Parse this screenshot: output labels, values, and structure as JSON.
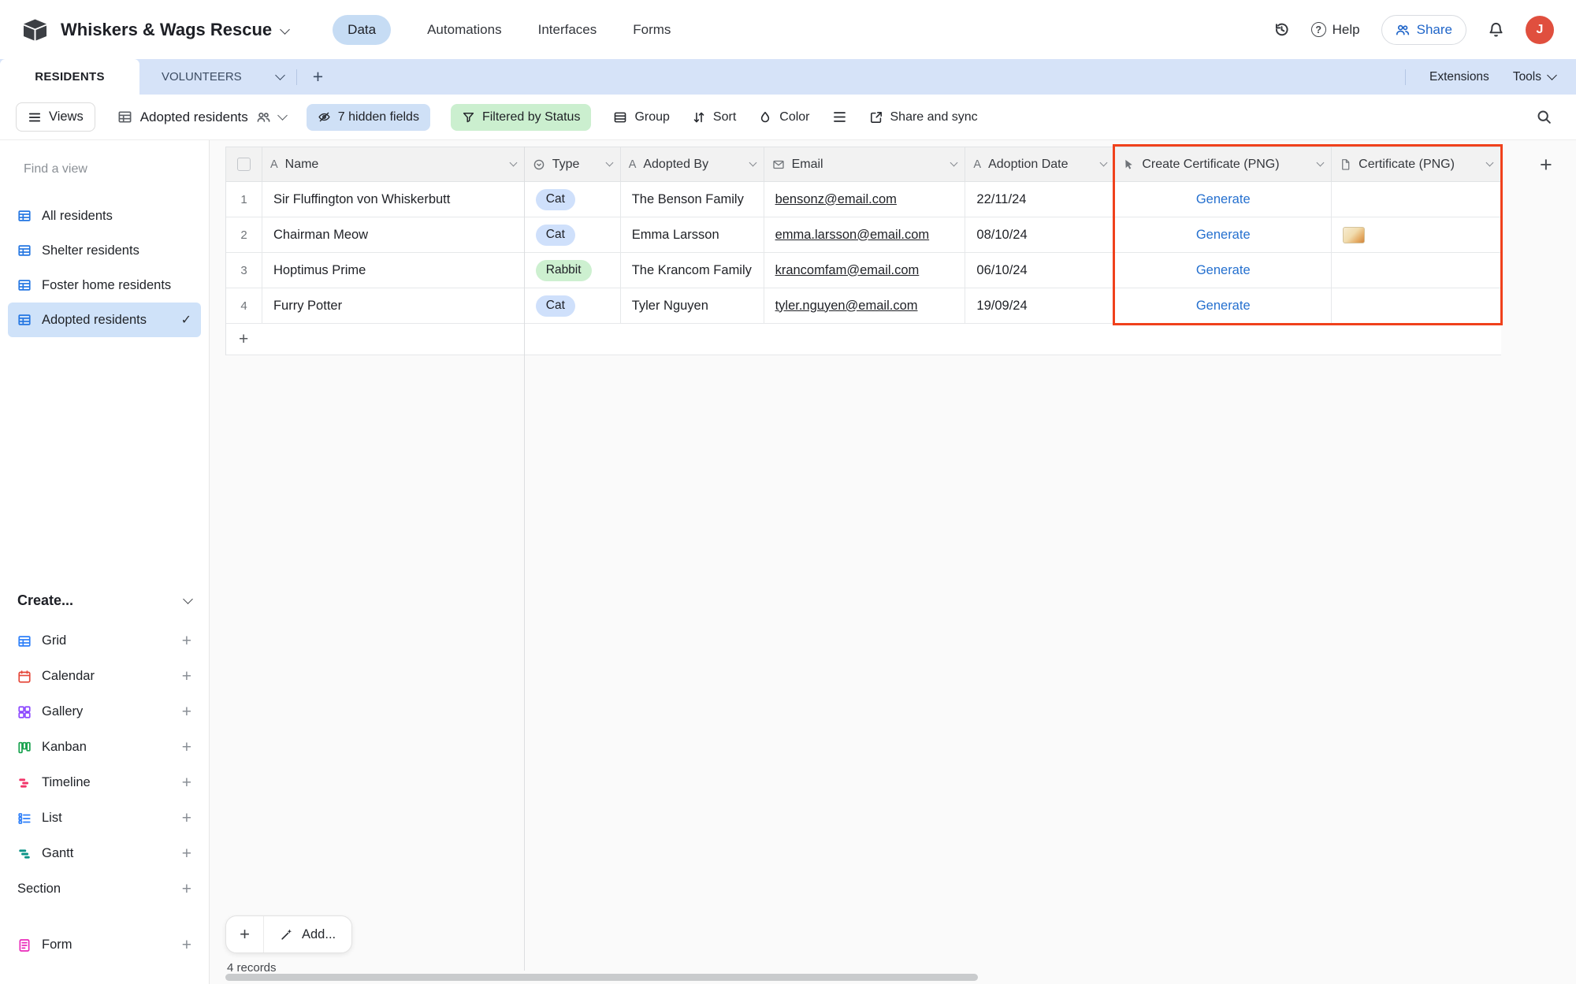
{
  "colors": {
    "accent_blue": "#2d7ff9",
    "tab_bar_blue": "#d6e3f8",
    "hidden_fields_pill": "#cfe0f6",
    "filter_pill_green": "#cbefcf",
    "type_pill_blue": "#cfe0fb",
    "type_pill_green": "#cdf0d0",
    "highlight_red": "#f0411c",
    "avatar_red": "#e04f3e"
  },
  "topbar": {
    "title": "Whiskers & Wags Rescue",
    "nav": [
      {
        "label": "Data",
        "active": true
      },
      {
        "label": "Automations",
        "active": false
      },
      {
        "label": "Interfaces",
        "active": false
      },
      {
        "label": "Forms",
        "active": false
      }
    ],
    "help_label": "Help",
    "share_label": "Share",
    "avatar_initial": "J"
  },
  "tabbar": {
    "residents": "RESIDENTS",
    "volunteers": "VOLUNTEERS",
    "extensions": "Extensions",
    "tools": "Tools"
  },
  "toolbar": {
    "views": "Views",
    "view_name": "Adopted residents",
    "hidden_fields": "7 hidden fields",
    "filter": "Filtered by Status",
    "group": "Group",
    "sort": "Sort",
    "color": "Color",
    "share_sync": "Share and sync"
  },
  "sidebar": {
    "find_placeholder": "Find a view",
    "views": [
      {
        "label": "All residents",
        "selected": false
      },
      {
        "label": "Shelter residents",
        "selected": false
      },
      {
        "label": "Foster home residents",
        "selected": false
      },
      {
        "label": "Adopted residents",
        "selected": true
      }
    ],
    "create_label": "Create...",
    "create_items": [
      {
        "label": "Grid"
      },
      {
        "label": "Calendar"
      },
      {
        "label": "Gallery"
      },
      {
        "label": "Kanban"
      },
      {
        "label": "Timeline"
      },
      {
        "label": "List"
      },
      {
        "label": "Gantt"
      },
      {
        "label": "Section"
      },
      {
        "label": "Form"
      }
    ]
  },
  "grid": {
    "columns": [
      {
        "label": "Name"
      },
      {
        "label": "Type"
      },
      {
        "label": "Adopted By"
      },
      {
        "label": "Email"
      },
      {
        "label": "Adoption Date"
      },
      {
        "label": "Create Certificate (PNG)"
      },
      {
        "label": "Certificate (PNG)"
      }
    ],
    "rows": [
      {
        "num": "1",
        "name": "Sir Fluffington von Whiskerbutt",
        "type": "Cat",
        "type_class": "pill-blue",
        "adopted_by": "The Benson Family",
        "email": "bensonz@email.com",
        "adoption_date": "22/11/24",
        "action": "Generate",
        "has_attachment": false
      },
      {
        "num": "2",
        "name": "Chairman Meow",
        "type": "Cat",
        "type_class": "pill-blue",
        "adopted_by": "Emma Larsson",
        "email": "emma.larsson@email.com",
        "adoption_date": "08/10/24",
        "action": "Generate",
        "has_attachment": true
      },
      {
        "num": "3",
        "name": "Hoptimus Prime",
        "type": "Rabbit",
        "type_class": "pill-green",
        "adopted_by": "The Krancom Family",
        "email": "krancomfam@email.com",
        "adoption_date": "06/10/24",
        "action": "Generate",
        "has_attachment": false
      },
      {
        "num": "4",
        "name": "Furry Potter",
        "type": "Cat",
        "type_class": "pill-blue",
        "adopted_by": "Tyler Nguyen",
        "email": "tyler.nguyen@email.com",
        "adoption_date": "19/09/24",
        "action": "Generate",
        "has_attachment": false
      }
    ],
    "add_label": "Add...",
    "record_count": "4 records"
  }
}
